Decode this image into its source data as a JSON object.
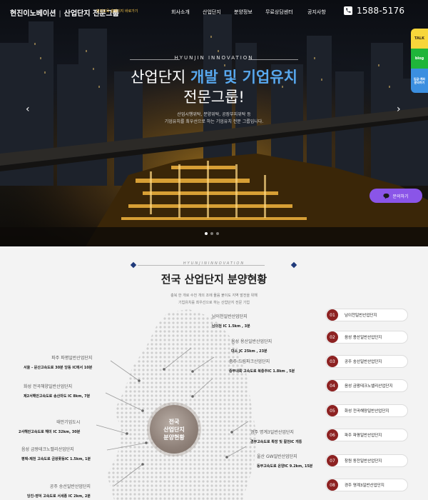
{
  "header": {
    "logo_main": "현진이노베이션",
    "logo_sep": "|",
    "logo_sub": "산업단지 전문그룹",
    "tagline": "현진교육 홈페이지 바로가기",
    "nav": [
      "회사소개",
      "산업단지",
      "분양정보",
      "무료상담센터",
      "공지사항"
    ],
    "phone": "1588-5176"
  },
  "hero": {
    "brand": "HYUNJIN INNOVATION",
    "headline_plain": "산업단지 ",
    "headline_accent": "개발 및 기업유치",
    "headline2": "전문그룹!",
    "desc1": "산업시행위탁, 분양위탁, 공장부지위탁 등",
    "desc2": "기업유치를 최우선으로 하는 기업유치 전문 그룹입니다.",
    "prev_arrow": "‹",
    "next_arrow": "›",
    "slides": 3,
    "active_slide": 0
  },
  "quick_menu": {
    "talk": "TALK",
    "blog": "blog",
    "consult_line1": "입금·계좌",
    "consult_line2": "문의하기"
  },
  "inquiry_button": "문의하기",
  "section": {
    "subtitle": "HYUNJININNOVATION",
    "title": "전국 산업단지 분양현황",
    "desc1": "충북 한 개로 수천 개의 조에 물음 붙이도 지역 발전을 위해",
    "desc2": "기업유치를 최우선으로 하는 산업단지 전문 기업"
  },
  "center_label": [
    "전국",
    "산업단지",
    "분양현황"
  ],
  "map_labels": [
    {
      "name": "남이천일반산업단지",
      "info": "남이천 IC 1.5km , 3분"
    },
    {
      "name": "음성 용산일반산업단지",
      "info": "대소 JC 25km , 23분"
    },
    {
      "name": "충주 드림파크산업단지",
      "info": "중부내륙 고속도로 북충주IC 1.8km , 5분"
    },
    {
      "name": "파주 파평일반산업단지",
      "info": "서울 - 문산고속도로 30분 당동 IC에서 10분"
    },
    {
      "name": "화성 전곡해양일반산업단지",
      "info": "제2서해안고속도로 송산마도 IC 8km, 7분"
    },
    {
      "name": "태안기업도시",
      "info": "2서해안고속도로 해미 IC 32km, 30분"
    },
    {
      "name": "음성 금왕테크노밸리산업단지",
      "info": "평택-제천 고속도로 금왕꽃동IC 1.5km, 1분"
    },
    {
      "name": "공주 송선일반산업단지",
      "info": "당진-영덕 고속도로 서세종 IC 2km, 2분"
    },
    {
      "name": "경주 명계3일반산업단지",
      "info": "경부고속도로 확장 및 활천IC 개통"
    },
    {
      "name": "울산 GW일반산업단지",
      "info": "동부고속도로 온양IC 9.2km, 15분"
    }
  ],
  "list": [
    {
      "num": "01",
      "label": "남이천일반산업단지"
    },
    {
      "num": "02",
      "label": "음성 용산일반산업단지"
    },
    {
      "num": "03",
      "label": "공주 송선일반산업단지"
    },
    {
      "num": "04",
      "label": "음성 금왕테크노밸리산업단지"
    },
    {
      "num": "05",
      "label": "화성 전곡해양일반산업단지"
    },
    {
      "num": "06",
      "label": "파주 파평일반산업단지"
    },
    {
      "num": "07",
      "label": "창원 동전일반산업단지"
    },
    {
      "num": "08",
      "label": "경주 명계3일반산업단지"
    }
  ],
  "colors": {
    "accent_blue": "#58a8ee",
    "number_badge": "#8d2222",
    "inquiry_purple": "#8a55e8",
    "diamond_navy": "#1f3a7a"
  }
}
